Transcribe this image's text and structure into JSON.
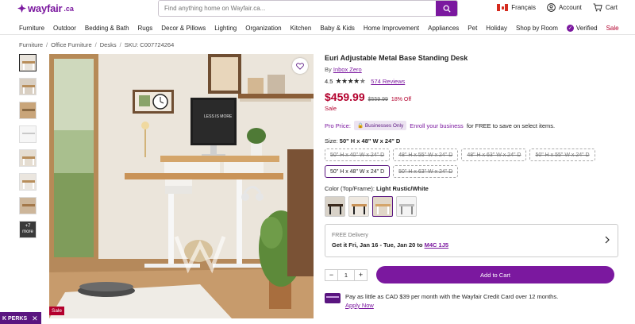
{
  "header": {
    "logo_text": "wayfair",
    "logo_tld": ".ca",
    "search_placeholder": "Find anything home on Wayfair.ca...",
    "language": "Français",
    "account": "Account",
    "cart": "Cart"
  },
  "nav": {
    "items": [
      "Furniture",
      "Outdoor",
      "Bedding & Bath",
      "Rugs",
      "Decor & Pillows",
      "Lighting",
      "Organization",
      "Kitchen",
      "Baby & Kids",
      "Home Improvement",
      "Appliances",
      "Pet",
      "Holiday",
      "Shop by Room"
    ],
    "verified": "Verified",
    "sale": "Sale"
  },
  "breadcrumb": {
    "items": [
      "Furniture",
      "Office Furniture",
      "Desks"
    ],
    "sku": "SKU: C007724264",
    "separator": "/"
  },
  "thumbnails": {
    "more_count": "+7",
    "more_label": "more"
  },
  "hero": {
    "sale_tag": "Sale",
    "monitor_text": "LESS IS MORE"
  },
  "perks": {
    "label": "K PERKS"
  },
  "product": {
    "title": "Euri Adjustable Metal Base Standing Desk",
    "by_prefix": "By",
    "brand": "Inbox Zero",
    "rating": "4.5",
    "reviews": "574 Reviews",
    "price": "$459.99",
    "was_price": "$559.99",
    "discount": "18% Off",
    "sale_label": "Sale",
    "pro_price_label": "Pro Price:",
    "businesses_only": "Businesses Only",
    "enroll_link": "Enroll your business",
    "enroll_rest": "for FREE to save on select items.",
    "size_label": "Size:",
    "size_selected": "50\" H x 48\" W x 24\" D",
    "sizes": [
      "50\" H x 40\" W x 24\" D",
      "48\" H x 55\" W x 24\" D",
      "48\" H x 63\" W x 24\" D",
      "50\" H x 55\" W x 24\" D",
      "50\" H x 48\" W x 24\" D",
      "50\" H x 63\" W x 24\" D"
    ],
    "color_label": "Color (Top/Frame):",
    "color_selected": "Light Rustic/White",
    "delivery_free": "FREE Delivery",
    "delivery_prefix": "Get it",
    "delivery_dates": "Fri, Jan 16 - Tue, Jan 20",
    "delivery_to": "to",
    "postal": "M4C 1J5",
    "qty": "1",
    "add_to_cart": "Add to Cart",
    "credit_text": "Pay as little as CAD $39 per month with the Wayfair Credit Card over 12 months.",
    "apply_now": "Apply Now"
  },
  "colors": {
    "brand": "#7b189f",
    "sale": "#b3002d"
  }
}
